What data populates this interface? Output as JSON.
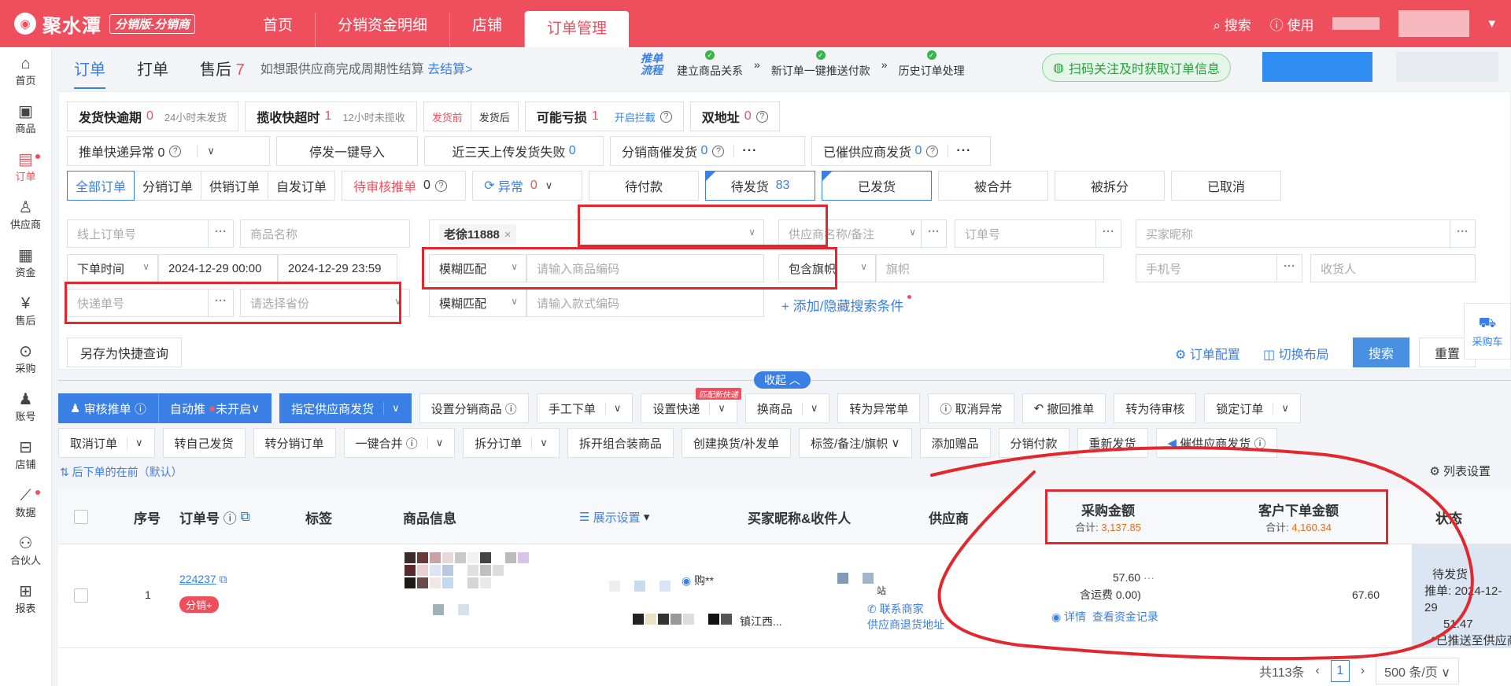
{
  "header": {
    "brand": "聚水潭",
    "brand_badge": "分销版-分销商",
    "nav": [
      "首页",
      "分销资金明细",
      "店铺",
      "订单管理"
    ],
    "search": "搜索",
    "help": "使用",
    "accent": "#ef4f5c"
  },
  "sidebar": {
    "items": [
      {
        "label": "首页",
        "icon": "home-icon"
      },
      {
        "label": "商品",
        "icon": "box-icon"
      },
      {
        "label": "订单",
        "icon": "order-icon"
      },
      {
        "label": "供应商",
        "icon": "person-icon"
      },
      {
        "label": "资金",
        "icon": "wallet-icon"
      },
      {
        "label": "售后",
        "icon": "yen-icon"
      },
      {
        "label": "采购",
        "icon": "pin-icon"
      },
      {
        "label": "账号",
        "icon": "user-icon"
      },
      {
        "label": "店铺",
        "icon": "shop-icon"
      },
      {
        "label": "数据",
        "icon": "chart-icon"
      },
      {
        "label": "合伙人",
        "icon": "team-icon"
      },
      {
        "label": "报表",
        "icon": "grid-icon"
      }
    ]
  },
  "subtabs": {
    "order": "订单",
    "print": "打单",
    "after_sale": "售后",
    "after_sale_count": "7",
    "hint": "如想跟供应商完成周期性结算",
    "hint_link": "去结算>"
  },
  "flow": {
    "title": "推单流程",
    "steps": [
      "建立商品关系",
      "新订单一键推送付款",
      "历史订单处理"
    ]
  },
  "qr_tip": "扫码关注及时获取订单信息",
  "quick_filters": {
    "row1": {
      "ship_overdue": "发货快逾期",
      "ship_overdue_count": "0",
      "ship_overdue_hint": "24小时未发货",
      "pickup_timeout": "揽收快超时",
      "pickup_timeout_count": "1",
      "pickup_timeout_hint": "12小时未揽收",
      "before_ship": "发货前",
      "after_ship": "发货后",
      "possible_loss": "可能亏损",
      "possible_loss_count": "1",
      "enable_intercept": "开启拦截",
      "dual_address": "双地址",
      "dual_address_count": "0"
    },
    "row2": {
      "push_express_error": "推单快递异常 0",
      "stop_ship_import": "停发一键导入",
      "upload_fail": "近三天上传发货失败",
      "upload_fail_count": "0",
      "distributor_urge": "分销商催发货",
      "distributor_urge_count": "0",
      "supplier_urged": "已催供应商发货",
      "supplier_urged_count": "0"
    },
    "status_tabs": {
      "all": "全部订单",
      "distribution": "分销订单",
      "supply": "供销订单",
      "self_ship": "自发订单",
      "pending_review": "待审核推单",
      "pending_review_count": "0",
      "abnormal": "异常",
      "abnormal_count": "0",
      "unpaid": "待付款",
      "to_ship": "待发货",
      "to_ship_count": "83",
      "shipped": "已发货",
      "merged": "被合并",
      "split": "被拆分",
      "cancelled": "已取消"
    }
  },
  "search_fields": {
    "online_order_no": "线上订单号",
    "product_name": "商品名称",
    "selected_tag": "老徐11888",
    "supplier": "供应商名称/备注",
    "order_no": "订单号",
    "buyer_nick": "买家昵称",
    "time_type": "下单时间",
    "time_start": "2024-12-29 00:00",
    "time_end": "2024-12-29 23:59",
    "fuzzy1": "模糊匹配",
    "product_code": "请输入商品编码",
    "include_flag": "包含旗帜",
    "flag": "旗帜",
    "phone": "手机号",
    "receiver": "收货人",
    "express_no": "快递单号",
    "province": "请选择省份",
    "fuzzy2": "模糊匹配",
    "style_code": "请输入款式编码",
    "add_condition": "+ 添加/隐藏搜索条件"
  },
  "search_buttons": {
    "save_quick": "另存为快捷查询",
    "order_config": "订单配置",
    "switch_layout": "切换布局",
    "search": "搜索",
    "reset": "重置"
  },
  "cart": "采购车",
  "collapse": "收起",
  "actions": {
    "row1": [
      "审核推单",
      "自动推",
      "未开启",
      "指定供应商发货",
      "设置分销商品",
      "手工下单",
      "设置快递",
      "换商品",
      "转为异常单",
      "取消异常",
      "撤回推单",
      "转为待审核",
      "锁定订单"
    ],
    "express_badge": "匹配新快递",
    "row2": [
      "取消订单",
      "转自己发货",
      "转分销订单",
      "一键合并",
      "拆分订单",
      "拆开组合装商品",
      "创建换货/补发单",
      "标签/备注/旗帜",
      "添加赠品",
      "分销付款",
      "重新发货",
      "催供应商发货"
    ]
  },
  "sort_hint": "后下单的在前（默认）",
  "column_setting": "列表设置",
  "table": {
    "headers": {
      "seq": "序号",
      "order_no": "订单号",
      "tags": "标签",
      "product": "商品信息",
      "display": "展示设置",
      "buyer": "买家昵称&收件人",
      "supplier": "供应商",
      "purchase_amount": "采购金额",
      "purchase_total_label": "合计:",
      "purchase_total": "3,137.85",
      "customer_amount": "客户下单金额",
      "customer_total_label": "合计:",
      "customer_total": "4,160.34",
      "status": "状态"
    },
    "rows": [
      {
        "seq": "1",
        "order_no": "224237",
        "tag": "分销+",
        "buyer_tag": "购**",
        "address_tail": "镇江西...",
        "supplier_tail": "站",
        "contact": "联系商家",
        "return_addr": "供应商退货地址",
        "purchase_amount": "57.60",
        "freight": "含运费 0.00)",
        "fund_link": "查看资金记录",
        "detail_link": "详情",
        "customer_amount": "67.60",
        "status": "待发货",
        "push_label": "推单:",
        "push_date": "2024-12-29",
        "push_time": "51:47",
        "pushed": "已推送至供应商"
      }
    ]
  },
  "pager": {
    "total": "共113条",
    "current": "1",
    "page_size": "500 条/页"
  }
}
